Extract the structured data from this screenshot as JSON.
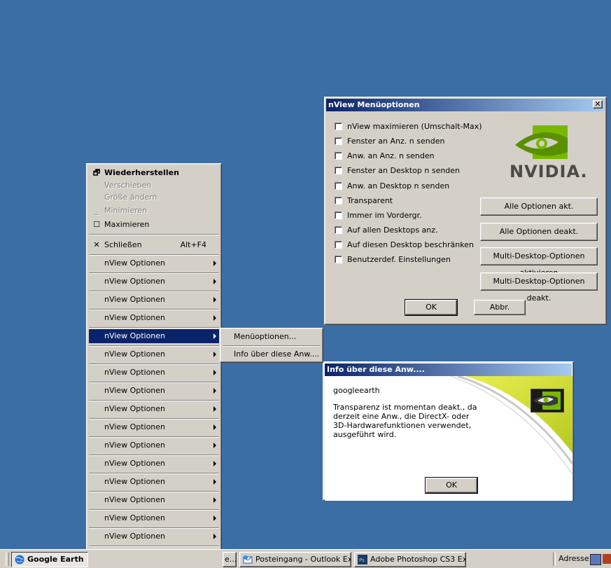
{
  "colors": {
    "desktop": "#3a6ea5",
    "highlight": "#0a246a",
    "nvidia_green": "#76b900"
  },
  "context_menu": {
    "restore": "Wiederherstellen",
    "move": "Verschieben",
    "size": "Größe ändern",
    "minimize": "Minimieren",
    "maximize": "Maximieren",
    "close": "Schließen",
    "close_shortcut": "Alt+F4",
    "nview_items": [
      "nView Optionen",
      "nView Optionen",
      "nView Optionen",
      "nView Optionen",
      "nView Optionen",
      "nView Optionen",
      "nView Optionen",
      "nView Optionen",
      "nView Optionen",
      "nView Optionen",
      "nView Optionen",
      "nView Optionen",
      "nView Optionen",
      "nView Optionen",
      "nView Optionen",
      "nView Optionen",
      "nView Optionen"
    ]
  },
  "submenu": {
    "items": [
      "Menüoptionen...",
      "Info über diese Anw...."
    ]
  },
  "menu_options_dialog": {
    "title": "nView Menüoptionen",
    "close_glyph": "✕",
    "checkboxes": [
      "nView maximieren (Umschalt-Max)",
      "Fenster an Anz. n senden",
      "Anw. an Anz. n senden",
      "Fenster an Desktop n senden",
      "Anw. an Desktop n senden",
      "Transparent",
      "Immer im Vordergr.",
      "Auf allen Desktops anz.",
      "Auf diesen Desktop beschränken",
      "Benutzerdef. Einstellungen"
    ],
    "logo_text": "NVIDIA.",
    "buttons": {
      "all_on": "Alle Optionen akt.",
      "all_off": "Alle Optionen deakt.",
      "multi_on": "Multi-Desktop-Optionen aktivieren",
      "multi_off": "Multi-Desktop-Optionen deakt.",
      "ok": "OK",
      "cancel": "Abbr."
    }
  },
  "info_dialog": {
    "title": "Info über diese Anw....",
    "app_name": "googleearth",
    "message": [
      "Transparenz ist momentan deakt., da",
      "derzeit eine Anw., die DirectX- oder",
      "3D-Hardwarefunktionen verwendet,",
      "ausgeführt wird."
    ],
    "ok": "OK"
  },
  "taskbar": {
    "tasks": [
      {
        "label": "Google Earth",
        "icon": "google-earth-icon",
        "active": true
      },
      {
        "label": "e...",
        "icon": "",
        "active": false
      },
      {
        "label": "Posteingang - Outlook Ex...",
        "icon": "outlook-express-icon",
        "active": false
      },
      {
        "label": "Adobe Photoshop CS3 Ex...",
        "icon": "photoshop-icon",
        "active": false
      }
    ],
    "address_label": "Adresse"
  }
}
